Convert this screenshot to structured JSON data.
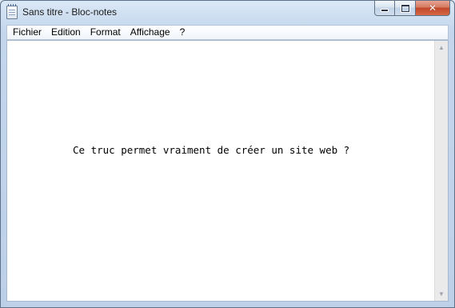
{
  "window": {
    "title": "Sans titre - Bloc-notes"
  },
  "caption_buttons": {
    "minimize": "minimize",
    "maximize": "maximize",
    "close": "close"
  },
  "menu": [
    {
      "label": "Fichier"
    },
    {
      "label": "Edition"
    },
    {
      "label": "Format"
    },
    {
      "label": "Affichage"
    },
    {
      "label": "?"
    }
  ],
  "editor": {
    "text": "Ce truc permet vraiment de créer un site web ?"
  },
  "icons": {
    "app": "notepad-icon",
    "scroll_up": "scroll-up-arrow-icon",
    "scroll_down": "scroll-down-arrow-icon"
  },
  "colors": {
    "close_button": "#c2462a",
    "frame": "#c3d6ec",
    "editor_bg": "#ffffff"
  }
}
